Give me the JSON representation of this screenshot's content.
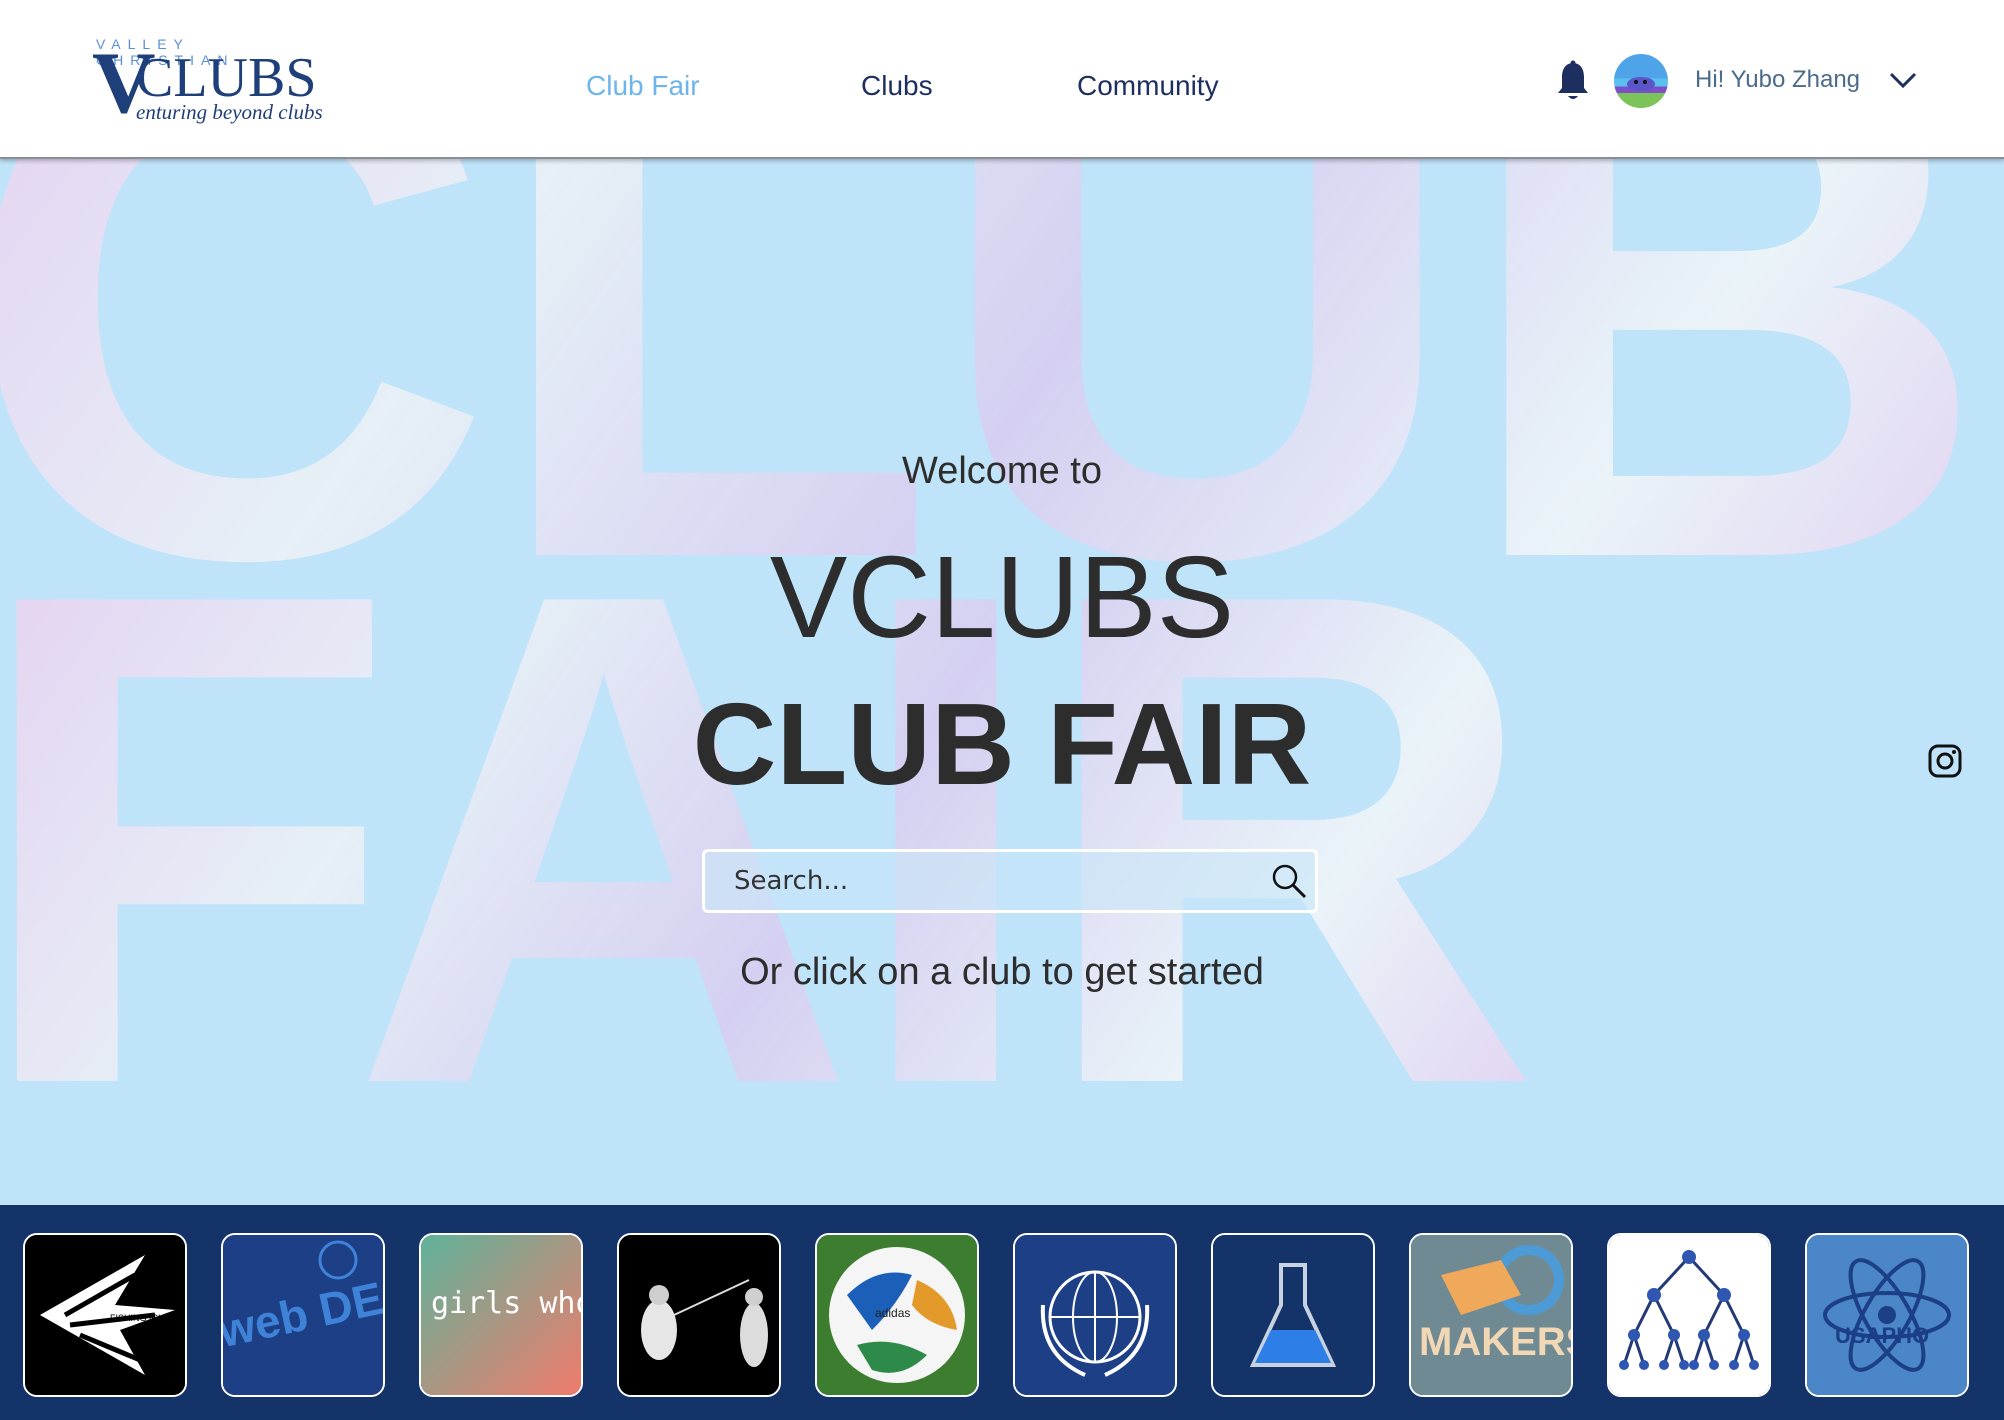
{
  "brand": {
    "top_text": "VALLEY CHRISTIAN",
    "big_letter": "V",
    "name": "CLUBS",
    "tagline": "enturing beyond clubs"
  },
  "nav": {
    "items": [
      {
        "label": "Club Fair",
        "active": true
      },
      {
        "label": "Clubs",
        "active": false
      },
      {
        "label": "Community",
        "active": false
      }
    ]
  },
  "user": {
    "greeting": "Hi! Yubo Zhang",
    "icons": [
      "bell-icon",
      "avatar",
      "chevron-down-icon"
    ]
  },
  "hero": {
    "background_word_1": "CLUB",
    "background_word_2": "FAIR",
    "welcome": "Welcome to",
    "title_line1": "VCLUBS",
    "title_line2": "CLUB FAIR",
    "search_placeholder": "Search...",
    "prompt": "Or click on a club to get started"
  },
  "social": {
    "icon": "instagram-icon"
  },
  "clubs": {
    "tiles": [
      {
        "name": "fishing-club",
        "text": "FISHING ICHTHYOLOGY SANCTUARY"
      },
      {
        "name": "web-design-club",
        "text": "web DESIGN"
      },
      {
        "name": "girls-who-code-club",
        "text": "girls who code"
      },
      {
        "name": "fencing-club"
      },
      {
        "name": "soccer-club",
        "text": "adidas"
      },
      {
        "name": "model-un-club"
      },
      {
        "name": "science-club"
      },
      {
        "name": "makers-club",
        "text": "MAKERS"
      },
      {
        "name": "data-structures-club"
      },
      {
        "name": "usapho-club",
        "text": "USAPHO"
      }
    ]
  },
  "colors": {
    "nav_active": "#6db5ea",
    "nav_text": "#1c2f5e",
    "hero_bg": "#bfe3f9",
    "strip_bg": "#143369"
  }
}
